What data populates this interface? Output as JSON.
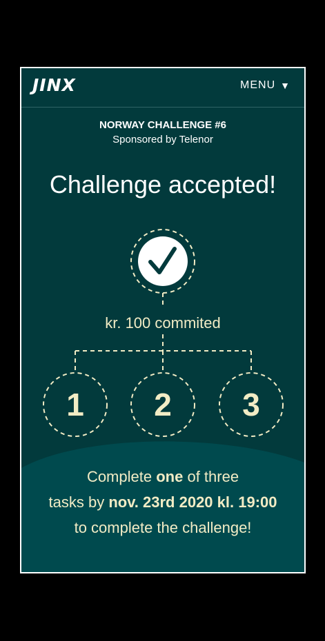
{
  "header": {
    "logo": "JINX",
    "menu_label": "MENU",
    "menu_icon": "triangle-down-icon"
  },
  "challenge": {
    "name": "NORWAY CHALLENGE #6",
    "sponsor": "Sponsored by Telenor",
    "headline": "Challenge accepted!",
    "status_icon": "checkmark-icon",
    "committed": "kr. 100 commited"
  },
  "steps": [
    "1",
    "2",
    "3"
  ],
  "instructions": {
    "l1_a": "Complete ",
    "l1_b": "one",
    "l1_c": " of three",
    "l2_a": "tasks by ",
    "l2_b": "nov. 23rd 2020 kl. 19:00",
    "l3": "to complete the challenge!"
  },
  "colors": {
    "background": "#023a3c",
    "wave": "#004a4e",
    "accent_text": "#f2ecc5",
    "outline": "#ffffff"
  }
}
